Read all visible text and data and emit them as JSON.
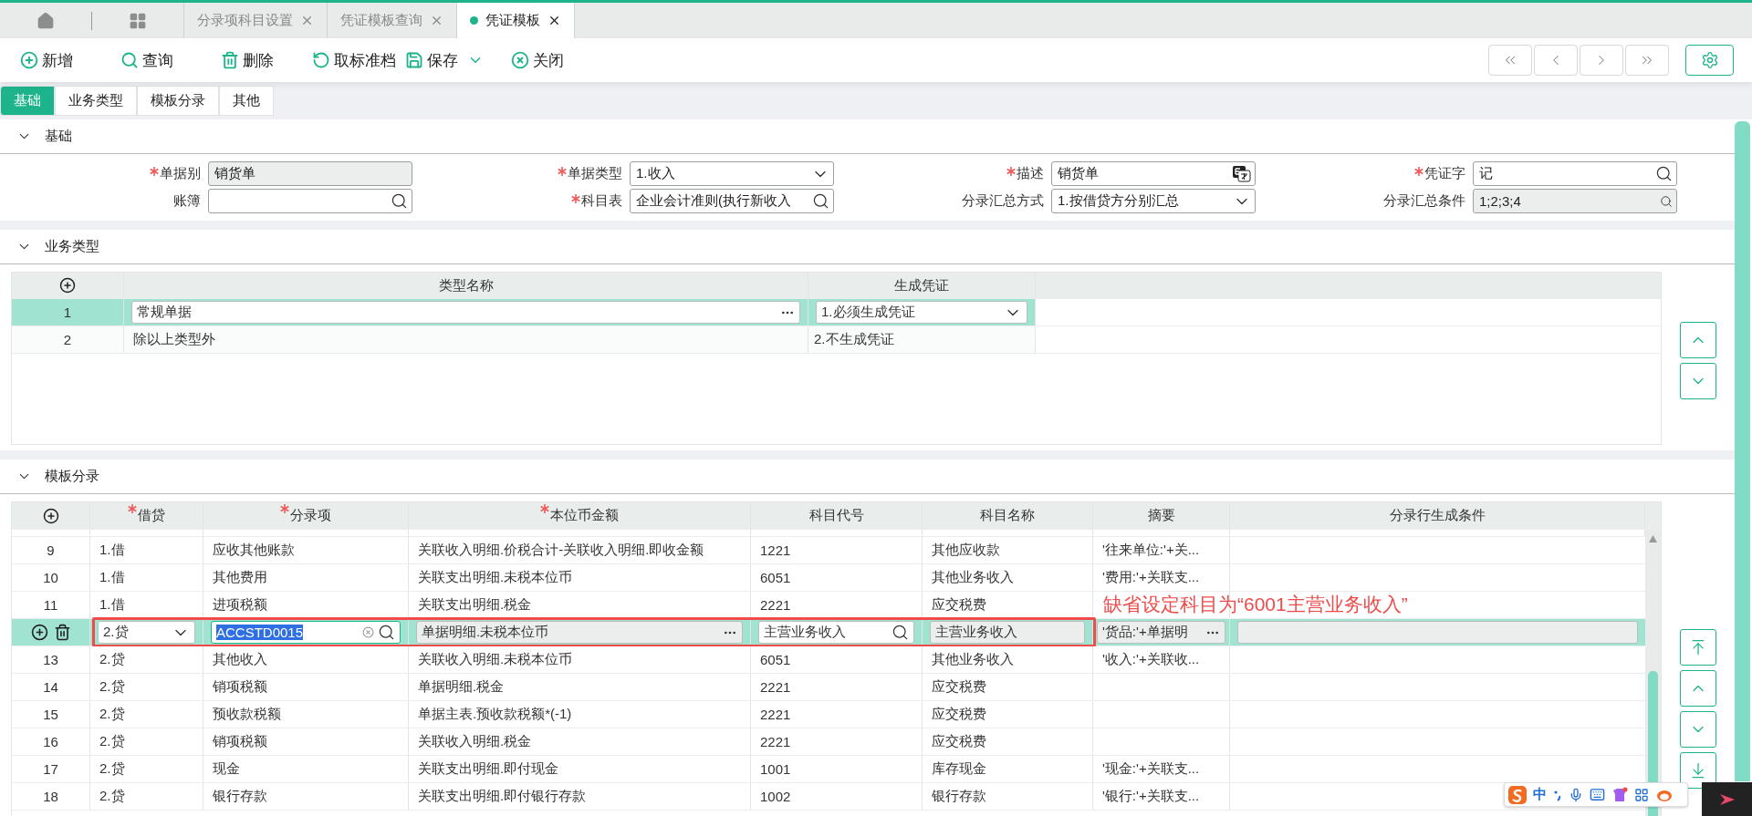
{
  "app_tabs": [
    {
      "label": "分录项科目设置",
      "selected": false
    },
    {
      "label": "凭证模板查询",
      "selected": false
    },
    {
      "label": "凭证模板",
      "selected": true
    }
  ],
  "toolbar": [
    {
      "kind": "add",
      "label": "新增"
    },
    {
      "kind": "search",
      "label": "查询"
    },
    {
      "kind": "delete",
      "label": "删除"
    },
    {
      "kind": "unarchive",
      "label": "取标准档"
    },
    {
      "kind": "save",
      "label": "保存"
    },
    {
      "kind": "close",
      "label": "关闭"
    }
  ],
  "form_tabs": [
    {
      "label": "基础",
      "selected": true
    },
    {
      "label": "业务类型",
      "selected": false
    },
    {
      "label": "模板分录",
      "selected": false
    },
    {
      "label": "其他",
      "selected": false
    }
  ],
  "basic": {
    "title": "基础",
    "fields": [
      {
        "label": "单据别",
        "required": true,
        "kind": "readonly",
        "value": "销货单"
      },
      {
        "label": "单据类型",
        "required": true,
        "kind": "select",
        "value": "1.收入"
      },
      {
        "label": "描述",
        "required": true,
        "kind": "translate",
        "value": "销货单"
      },
      {
        "label": "凭证字",
        "required": true,
        "kind": "lookup",
        "value": "记"
      },
      {
        "label": "账簿",
        "required": false,
        "kind": "lookup"
      },
      {
        "label": "科目表",
        "required": true,
        "kind": "lookup",
        "value": "企业会计准则(执行新收入"
      },
      {
        "label": "分录汇总方式",
        "required": false,
        "kind": "select",
        "value": "1.按借贷方分别汇总"
      },
      {
        "label": "分录汇总条件",
        "required": false,
        "kind": "lookup_readonly",
        "value": "1;2;3;4"
      }
    ]
  },
  "business_types": {
    "title": "业务类型",
    "columns": [
      "类型名称",
      "生成凭证"
    ],
    "rows": [
      {
        "no": "1",
        "name": "常规单据",
        "voucher": "1.必须生成凭证",
        "selected": true
      },
      {
        "no": "2",
        "name": "除以上类型外",
        "voucher": "2.不生成凭证",
        "selected": false
      }
    ]
  },
  "entries": {
    "title": "模板分录",
    "annotation": "缺省设定科目为“6001主营业务收入”",
    "columns": [
      {
        "label": "借贷",
        "required": true
      },
      {
        "label": "分录项",
        "required": true
      },
      {
        "label": "本位币金额",
        "required": true
      },
      {
        "label": "科目代号",
        "required": false
      },
      {
        "label": "科目名称",
        "required": false
      },
      {
        "label": "摘要",
        "required": false
      },
      {
        "label": "分录行生成条件",
        "required": false
      }
    ],
    "rows": [
      {
        "no": "9",
        "dc": "1.借",
        "item": "应收其他账款",
        "amount": "关联收入明细.价税合计-关联收入明细.即收金额",
        "code": "1221",
        "name": "其他应收款",
        "summary": "'往来单位:'+关...",
        "selected": false
      },
      {
        "no": "10",
        "dc": "1.借",
        "item": "其他费用",
        "amount": "关联支出明细.未税本位币",
        "code": "6051",
        "name": "其他业务收入",
        "summary": "'费用:'+关联支...",
        "selected": false
      },
      {
        "no": "11",
        "dc": "1.借",
        "item": "进项税额",
        "amount": "关联支出明细.税金",
        "code": "2221",
        "name": "应交税费",
        "selected": false
      },
      {
        "dc": "2.贷",
        "item": "ACCSTD0015",
        "item_highlighted": true,
        "amount": "单据明细.未税本位币",
        "code": "主营业务收入",
        "name": "主营业务收入",
        "summary": "'货品:'+单据明",
        "selected": true
      },
      {
        "no": "13",
        "dc": "2.贷",
        "item": "其他收入",
        "amount": "关联收入明细.未税本位币",
        "code": "6051",
        "name": "其他业务收入",
        "summary": "'收入:'+关联收...",
        "selected": false
      },
      {
        "no": "14",
        "dc": "2.贷",
        "item": "销项税额",
        "amount": "单据明细.税金",
        "code": "2221",
        "name": "应交税费",
        "selected": false
      },
      {
        "no": "15",
        "dc": "2.贷",
        "item": "预收款税额",
        "amount": "单据主表.预收款税额*(-1)",
        "code": "2221",
        "name": "应交税费",
        "selected": false
      },
      {
        "no": "16",
        "dc": "2.贷",
        "item": "销项税额",
        "amount": "关联收入明细.税金",
        "code": "2221",
        "name": "应交税费",
        "selected": false
      },
      {
        "no": "17",
        "dc": "2.贷",
        "item": "现金",
        "amount": "关联支出明细.即付现金",
        "code": "1001",
        "name": "库存现金",
        "summary": "'现金:'+关联支...",
        "selected": false
      },
      {
        "no": "18",
        "dc": "2.贷",
        "item": "银行存款",
        "amount": "关联支出明细.即付银行存款",
        "code": "1002",
        "name": "银行存款",
        "summary": "'银行:'+关联支...",
        "selected": false
      }
    ]
  },
  "ime_bar": {
    "mode": "中"
  }
}
